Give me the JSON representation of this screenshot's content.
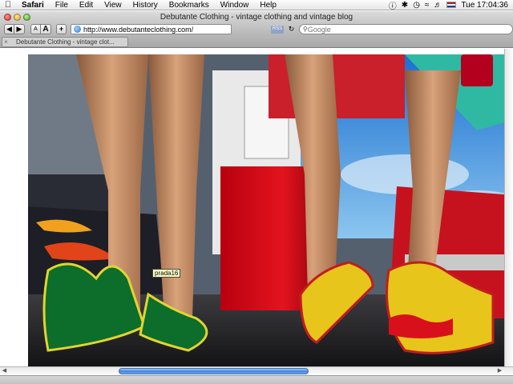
{
  "menubar": {
    "app": "Safari",
    "menus": [
      "File",
      "Edit",
      "View",
      "History",
      "Bookmarks",
      "Window",
      "Help"
    ],
    "clock": "Tue 17:04:36"
  },
  "window": {
    "title": "Debutante Clothing - vintage clothing and vintage blog"
  },
  "toolbar": {
    "text_small": "A",
    "text_large": "A",
    "add": "+",
    "address": "http://www.debutanteclothing.com/",
    "rss": "RSS",
    "search_placeholder": "Google"
  },
  "tabs": [
    {
      "label": "Debutante Clothing - vintage clot..."
    }
  ],
  "image": {
    "tooltip": "prada16"
  }
}
